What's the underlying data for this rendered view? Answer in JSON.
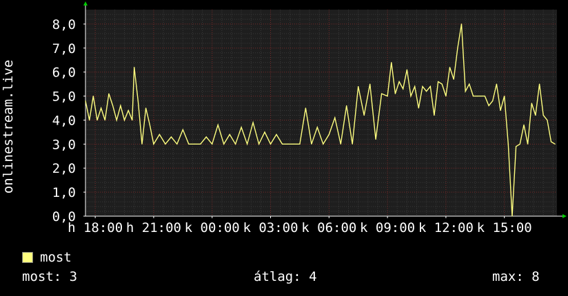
{
  "chart_data": {
    "type": "line",
    "ylabel": "onlinestream.live",
    "yticks": [
      "0,0",
      "1,0",
      "2,0",
      "3,0",
      "4,0",
      "5,0",
      "6,0",
      "7,0",
      "8,0"
    ],
    "xticks": [
      "h 18:00",
      "h 21:00",
      "k 00:00",
      "k 03:00",
      "k 06:00",
      "k 09:00",
      "k 12:00",
      "k 15:00"
    ],
    "xlim_hours": [
      17.5,
      41.7
    ],
    "ylim": [
      0,
      8.6
    ],
    "series": [
      {
        "name": "most",
        "color": "#ffff80",
        "x": [
          17.5,
          17.7,
          17.9,
          18.1,
          18.3,
          18.5,
          18.7,
          18.9,
          19.1,
          19.3,
          19.5,
          19.7,
          19.9,
          20.0,
          20.2,
          20.4,
          20.6,
          20.8,
          21.0,
          21.3,
          21.6,
          21.9,
          22.2,
          22.5,
          22.8,
          23.1,
          23.4,
          23.7,
          24.0,
          24.3,
          24.6,
          24.9,
          25.2,
          25.5,
          25.8,
          26.1,
          26.4,
          26.7,
          27.0,
          27.3,
          27.6,
          27.9,
          28.2,
          28.5,
          28.8,
          29.1,
          29.4,
          29.7,
          30.0,
          30.3,
          30.6,
          30.9,
          31.2,
          31.5,
          31.8,
          32.1,
          32.4,
          32.7,
          33.0,
          33.2,
          33.4,
          33.6,
          33.8,
          34.0,
          34.2,
          34.4,
          34.6,
          34.8,
          35.0,
          35.2,
          35.4,
          35.6,
          35.8,
          36.0,
          36.2,
          36.4,
          36.6,
          36.8,
          37.0,
          37.2,
          37.4,
          37.6,
          37.8,
          38.0,
          38.2,
          38.4,
          38.6,
          38.8,
          39.0,
          39.2,
          39.4,
          39.6,
          39.8,
          40.0,
          40.2,
          40.4,
          40.6,
          40.8,
          41.0,
          41.2,
          41.4,
          41.6
        ],
        "y": [
          4.8,
          4.0,
          5.0,
          4.0,
          4.5,
          4.0,
          5.1,
          4.6,
          4.0,
          4.6,
          4.0,
          4.4,
          4.0,
          6.2,
          4.8,
          3.0,
          4.5,
          3.8,
          3.0,
          3.4,
          3.0,
          3.3,
          3.0,
          3.6,
          3.0,
          3.0,
          3.0,
          3.3,
          3.0,
          3.8,
          3.0,
          3.4,
          3.0,
          3.7,
          3.0,
          3.9,
          3.0,
          3.5,
          3.0,
          3.4,
          3.0,
          3.0,
          3.0,
          3.0,
          4.5,
          3.0,
          3.7,
          3.0,
          3.4,
          4.1,
          3.0,
          4.6,
          3.0,
          5.4,
          4.2,
          5.5,
          3.2,
          5.1,
          5.0,
          6.4,
          5.1,
          5.6,
          5.3,
          6.1,
          5.0,
          5.4,
          4.5,
          5.4,
          5.2,
          5.4,
          4.2,
          5.6,
          5.5,
          5.0,
          6.2,
          5.7,
          7.0,
          8.0,
          5.2,
          5.5,
          5.0,
          5.0,
          5.0,
          5.0,
          4.6,
          4.8,
          5.5,
          4.4,
          5.0,
          3.0,
          0.0,
          2.9,
          3.0,
          3.8,
          3.0,
          4.7,
          4.2,
          5.5,
          4.2,
          4.0,
          3.1,
          3.0
        ]
      }
    ],
    "grid": true,
    "legend_position": "bottom-left"
  },
  "legend": {
    "label": "most",
    "color": "#ffff80"
  },
  "stats": {
    "current": "most: 3",
    "average": "átlag: 4",
    "max": "max: 8"
  },
  "colors": {
    "background": "#000000",
    "plot_background": "#1e1e1e",
    "grid_major": "#7a2a2a",
    "grid_minor": "#3a3a3a",
    "axis": "#ffffff",
    "arrow": "#00cc00"
  }
}
